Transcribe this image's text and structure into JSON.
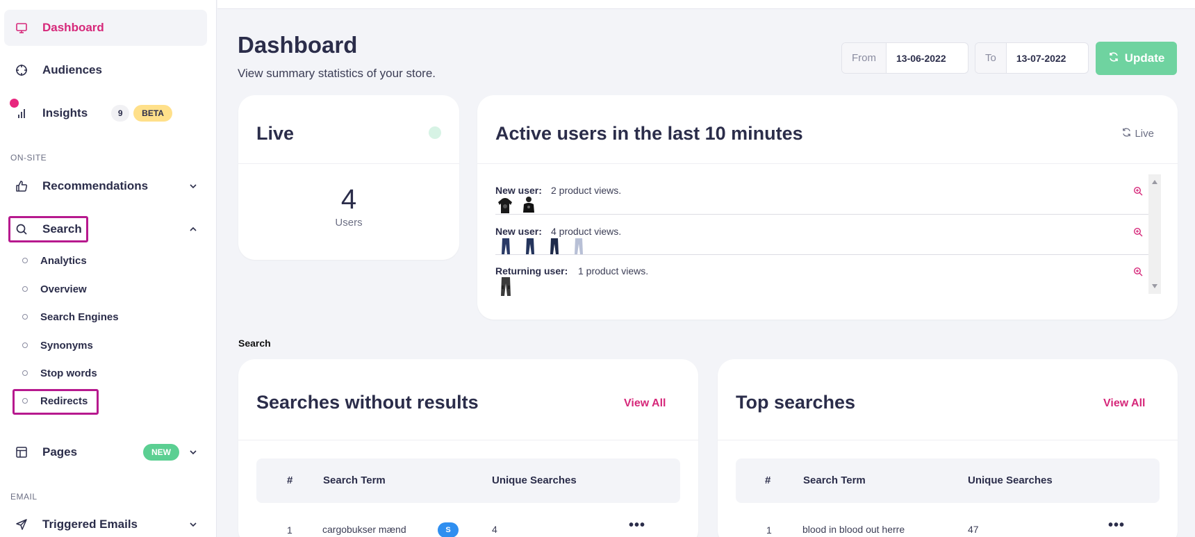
{
  "sidebar": {
    "dashboard": "Dashboard",
    "audiences": "Audiences",
    "insights": "Insights",
    "insights_count": "9",
    "insights_badge": "BETA",
    "section_onsite": "ON-SITE",
    "recommendations": "Recommendations",
    "search": "Search",
    "search_sub": [
      "Analytics",
      "Overview",
      "Search Engines",
      "Synonyms",
      "Stop words",
      "Redirects"
    ],
    "pages": "Pages",
    "pages_badge": "NEW",
    "section_email": "EMAIL",
    "triggered_emails": "Triggered Emails"
  },
  "header": {
    "title": "Dashboard",
    "subtitle": "View summary statistics of your store.",
    "from_label": "From",
    "from_value": "13-06-2022",
    "to_label": "To",
    "to_value": "13-07-2022",
    "update_label": "Update"
  },
  "live_card": {
    "title": "Live",
    "count": "4",
    "unit": "Users"
  },
  "active_card": {
    "title": "Active users in the last 10 minutes",
    "live_link": "Live",
    "rows": [
      {
        "user": "New user:",
        "views": "2 product views."
      },
      {
        "user": "New user:",
        "views": "4 product views."
      },
      {
        "user": "Returning user:",
        "views": "1 product views."
      }
    ]
  },
  "search_section": "Search",
  "no_results": {
    "title": "Searches without results",
    "view_all": "View All",
    "headers": [
      "#",
      "Search Term",
      "Unique Searches"
    ],
    "rows": [
      {
        "rank": "1",
        "term": "cargobukser mænd",
        "badge": "S",
        "count": "4"
      }
    ]
  },
  "top_searches": {
    "title": "Top searches",
    "view_all": "View All",
    "headers": [
      "#",
      "Search Term",
      "Unique Searches"
    ],
    "rows": [
      {
        "rank": "1",
        "term": "blood in blood out herre",
        "count": "47"
      }
    ]
  },
  "colors": {
    "accent": "#d6287a",
    "success": "#6fd3a0",
    "highlight": "#b7198e",
    "badge_blue": "#2f8ff0"
  }
}
